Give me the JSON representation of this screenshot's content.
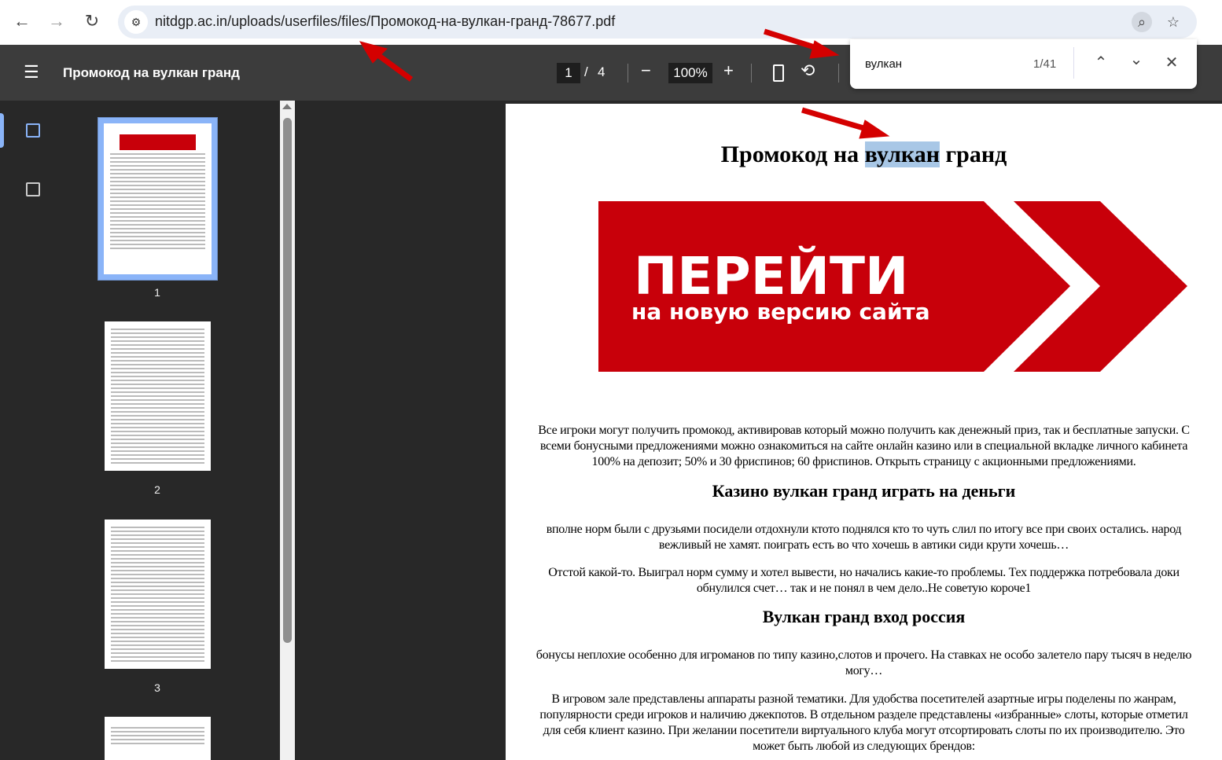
{
  "browser": {
    "url": "nitdgp.ac.in/uploads/userfiles/files/Промокод-на-вулкан-гранд-78677.pdf"
  },
  "viewer": {
    "title": "Промокод на вулкан гранд",
    "current_page": "1",
    "page_sep": "/",
    "total_pages": "4",
    "zoom": "100%"
  },
  "find": {
    "query": "вулкан",
    "count": "1/41"
  },
  "thumbnails": [
    {
      "label": "1"
    },
    {
      "label": "2"
    },
    {
      "label": "3"
    }
  ],
  "document": {
    "title_pre": "Промокод на ",
    "title_hl": "вулкан",
    "title_post": " гранд",
    "banner": {
      "big": "ПЕРЕЙТИ",
      "small": "на новую версию сайта",
      "color": "#c8000a"
    },
    "blocks": [
      {
        "type": "p",
        "lines": [
          "Все игроки могут получить промокод, активировав который можно получить как денежный приз, так и бесплатные запуски. С",
          "всеми бонусными предложениями можно ознакомиться на сайте онлайн казино или в специальной вкладке личного кабинета",
          "100% на депозит; 50% и 30 фриспинов; 60 фриспинов. Открыть страницу с акционными предложениями."
        ]
      },
      {
        "type": "h",
        "text": "Казино вулкан гранд играть на деньги"
      },
      {
        "type": "p",
        "lines": [
          "вполне норм были с друзьями посидели отдохнули ктото поднялся кто то чуть слил по итогу все при своих остались. народ",
          "вежливый не хамят. поиграть есть во что хочешь в автики сиди крути хочешь…"
        ]
      },
      {
        "type": "p",
        "lines": [
          "Отстой какой-то. Выиграл норм сумму и хотел вывести, но начались какие-то проблемы. Тех поддержка потребовала доки",
          "обнулился счет… так и не понял в чем дело..Не советую короче1"
        ]
      },
      {
        "type": "h",
        "text": "Вулкан гранд вход россия"
      },
      {
        "type": "p",
        "lines": [
          "бонусы неплохие особенно для игроманов по типу казино,слотов и прочего. На ставках не особо залетело пару тысяч в неделю",
          "могу…"
        ]
      },
      {
        "type": "p",
        "lines": [
          "В игровом зале представлены аппараты разной тематики. Для удобства посетителей азартные игры поделены по жанрам,",
          "популярности среди игроков и наличию джекпотов. В отдельном разделе представлены «избранные» слоты, которые отметил",
          "для себя клиент казино. При желании посетители виртуального клуба могут отсортировать слоты по их производителю. Это",
          "может быть любой из следующих брендов:"
        ]
      }
    ]
  }
}
